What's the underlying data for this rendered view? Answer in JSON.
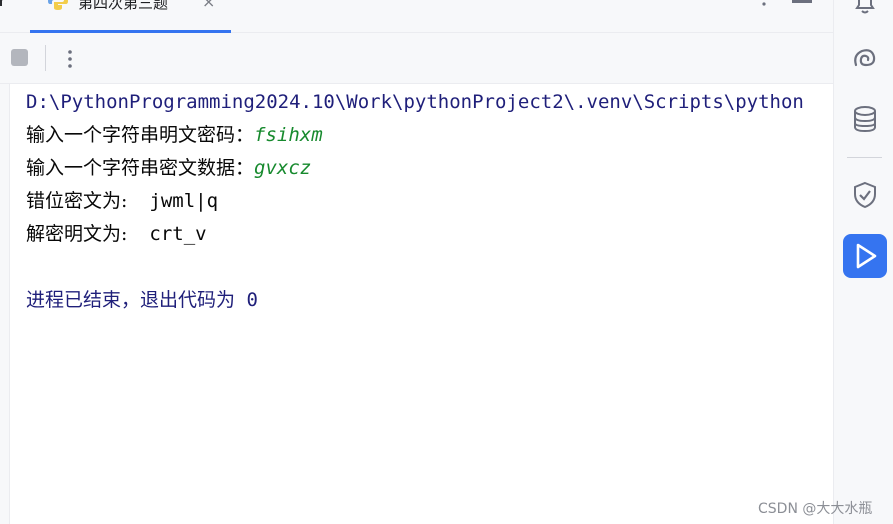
{
  "tab": {
    "label": "第四次第三题",
    "close": "×"
  },
  "console": {
    "command_path": "D:\\PythonProgramming2024.10\\Work\\pythonProject2\\.venv\\Scripts\\python",
    "lines": [
      {
        "prompt": "输入一个字符串明文密码：",
        "value": "fsihxm"
      },
      {
        "prompt": "输入一个字符串密文数据：",
        "value": "gvxcz"
      },
      {
        "prompt": "错位密文为:",
        "value": "jwml|q"
      },
      {
        "prompt": "解密明文为:",
        "value": "crt_v"
      }
    ],
    "exit_text": "进程已结束，退出代码为",
    "exit_code": "0"
  },
  "watermark": "CSDN @大大水瓶",
  "colors": {
    "accent": "#3574f0",
    "input_green": "#178a2e",
    "path_blue": "#1f1f7a"
  }
}
